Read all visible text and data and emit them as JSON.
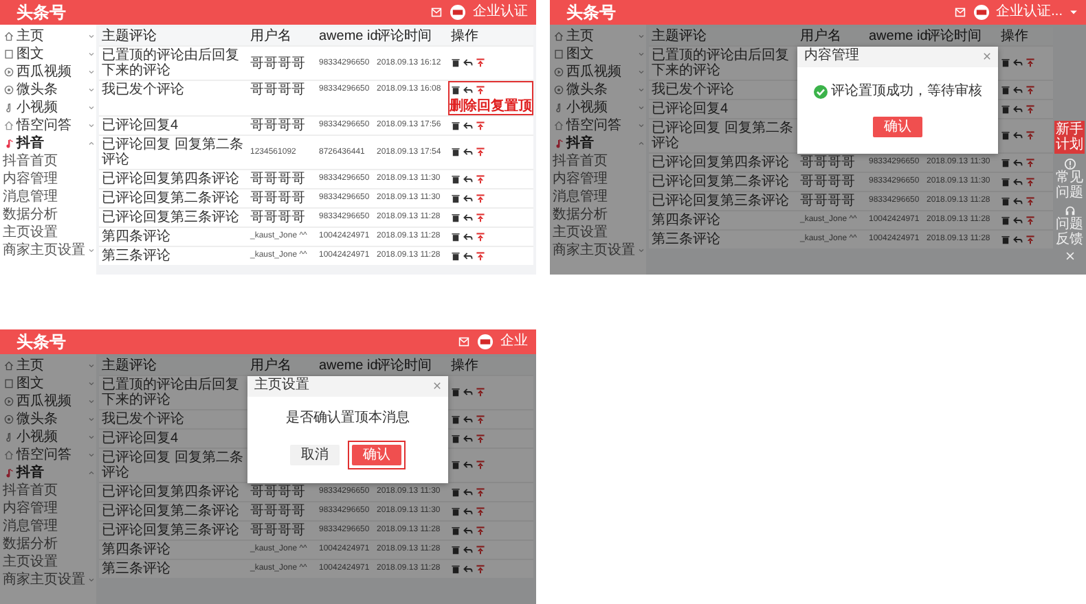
{
  "panels": [
    {
      "header": {
        "logo": "头条号",
        "account": "企业认证"
      },
      "sidebar": [
        {
          "label": "主页",
          "expanded": false
        },
        {
          "label": "图文",
          "expanded": false
        },
        {
          "label": "西瓜视频",
          "expanded": false
        },
        {
          "label": "微头条",
          "expanded": false
        },
        {
          "label": "小视频",
          "expanded": false
        },
        {
          "label": "悟空问答",
          "expanded": false
        },
        {
          "label": "抖音",
          "expanded": true,
          "children": [
            {
              "label": "抖音首页"
            },
            {
              "label": "内容管理"
            },
            {
              "label": "消息管理"
            },
            {
              "label": "数据分析"
            },
            {
              "label": "主页设置"
            },
            {
              "label": "商家主页设置",
              "expanded": false
            }
          ]
        }
      ],
      "table": {
        "columns": [
          "主题评论",
          "用户名",
          "aweme id",
          "评论时间",
          "操作"
        ],
        "rows": [
          {
            "comment": "已置顶的评论由后回复下来的评论",
            "user": "哥哥哥哥",
            "aweme_id": "98334296650",
            "time": "2018.09.13 16:12"
          },
          {
            "comment": "我已发个评论",
            "user": "哥哥哥哥",
            "aweme_id": "98334296650",
            "time": "2018.09.13 16:08",
            "annotation": {
              "labels": [
                "删除",
                "回复",
                "置顶"
              ]
            }
          },
          {
            "comment": "已评论回复4",
            "user": "哥哥哥哥",
            "aweme_id": "98334296650",
            "time": "2018.09.13 17:56"
          },
          {
            "comment": "已评论回复 回复第二条评论",
            "user": "1234561092",
            "aweme_id": "8726436441",
            "time": "2018.09.13 17:54"
          },
          {
            "comment": "已评论回复第四条评论",
            "user": "哥哥哥哥",
            "aweme_id": "98334296650",
            "time": "2018.09.13 11:30"
          },
          {
            "comment": "已评论回复第二条评论",
            "user": "哥哥哥哥",
            "aweme_id": "98334296650",
            "time": "2018.09.13 11:30"
          },
          {
            "comment": "已评论回复第三条评论",
            "user": "哥哥哥哥",
            "aweme_id": "98334296650",
            "time": "2018.09.13 11:28"
          },
          {
            "comment": "第四条评论",
            "user": "_kaust_Jone ^^",
            "aweme_id": "10042424971",
            "time": "2018.09.13 11:28"
          },
          {
            "comment": "第三条评论",
            "user": "_kaust_Jone ^^",
            "aweme_id": "10042424971",
            "time": "2018.09.13 11:28"
          }
        ]
      }
    },
    {
      "header": {
        "logo": "头条号",
        "account": "企业认证...",
        "account_menu": true
      },
      "sidebar": [
        {
          "label": "主页",
          "expanded": false
        },
        {
          "label": "图文",
          "expanded": false
        },
        {
          "label": "西瓜视频",
          "expanded": false
        },
        {
          "label": "微头条",
          "expanded": false
        },
        {
          "label": "小视频",
          "expanded": false
        },
        {
          "label": "悟空问答",
          "expanded": false
        },
        {
          "label": "抖音",
          "expanded": true,
          "children": [
            {
              "label": "抖音首页"
            },
            {
              "label": "内容管理"
            },
            {
              "label": "消息管理"
            },
            {
              "label": "数据分析"
            },
            {
              "label": "主页设置"
            },
            {
              "label": "商家主页设置",
              "expanded": false
            }
          ]
        }
      ],
      "table": {
        "columns": [
          "主题评论",
          "用户名",
          "aweme id",
          "评论时间",
          "操作"
        ],
        "rows": [
          {
            "comment": "已置顶的评论由后回复下来的评论"
          },
          {
            "comment": "我已发个评论"
          },
          {
            "comment": "已评论回复4"
          },
          {
            "comment": "已评论回复 回复第二条评论"
          },
          {
            "comment": "已评论回复第四条评论",
            "user": "哥哥哥哥",
            "aweme_id": "98334296650",
            "time": "2018.09.13 11:30"
          },
          {
            "comment": "已评论回复第二条评论",
            "user": "哥哥哥哥",
            "aweme_id": "98334296650",
            "time": "2018.09.13 11:30"
          },
          {
            "comment": "已评论回复第三条评论",
            "user": "哥哥哥哥",
            "aweme_id": "98334296650",
            "time": "2018.09.13 11:28"
          },
          {
            "comment": "第四条评论",
            "user": "_kaust_Jone ^^",
            "aweme_id": "10042424971",
            "time": "2018.09.13 11:28"
          },
          {
            "comment": "第三条评论",
            "user": "_kaust_Jone ^^",
            "aweme_id": "10042424971",
            "time": "2018.09.13 11:28"
          }
        ]
      },
      "dialog": {
        "kind": "notice",
        "title": "内容管理",
        "message": "评论置顶成功，等待审核",
        "buttons": [
          {
            "label": "确认",
            "primary": true,
            "highlighted": false
          }
        ]
      },
      "help_widget": {
        "badge": "新手计划",
        "items": [
          "常见问题",
          "问题反馈"
        ]
      }
    },
    {
      "header": {
        "logo": "头条号",
        "account": "企业"
      },
      "sidebar": [
        {
          "label": "主页",
          "expanded": false
        },
        {
          "label": "图文",
          "expanded": false
        },
        {
          "label": "西瓜视频",
          "expanded": false
        },
        {
          "label": "微头条",
          "expanded": false
        },
        {
          "label": "小视频",
          "expanded": false
        },
        {
          "label": "悟空问答",
          "expanded": false
        },
        {
          "label": "抖音",
          "expanded": true,
          "children": [
            {
              "label": "抖音首页"
            },
            {
              "label": "内容管理"
            },
            {
              "label": "消息管理"
            },
            {
              "label": "数据分析"
            },
            {
              "label": "主页设置"
            },
            {
              "label": "商家主页设置",
              "expanded": false
            }
          ]
        }
      ],
      "table": {
        "columns": [
          "主题评论",
          "用户名",
          "aweme id",
          "评论时间",
          "操作"
        ],
        "rows": [
          {
            "comment": "已置顶的评论由后回复下来的评论"
          },
          {
            "comment": "我已发个评论"
          },
          {
            "comment": "已评论回复4"
          },
          {
            "comment": "已评论回复 回复第二条评论"
          },
          {
            "comment": "已评论回复第四条评论",
            "user": "哥哥哥哥",
            "aweme_id": "98334296650",
            "time": "2018.09.13 11:30"
          },
          {
            "comment": "已评论回复第二条评论",
            "user": "哥哥哥哥",
            "aweme_id": "98334296650",
            "time": "2018.09.13 11:30"
          },
          {
            "comment": "已评论回复第三条评论",
            "user": "哥哥哥哥",
            "aweme_id": "98334296650",
            "time": "2018.09.13 11:28"
          },
          {
            "comment": "第四条评论",
            "user": "_kaust_Jone ^^",
            "aweme_id": "10042424971",
            "time": "2018.09.13 11:28"
          },
          {
            "comment": "第三条评论",
            "user": "_kaust_Jone ^^",
            "aweme_id": "10042424971",
            "time": "2018.09.13 11:28"
          }
        ]
      },
      "dialog": {
        "kind": "confirm",
        "title": "主页设置",
        "message": "是否确认置顶本消息",
        "buttons": [
          {
            "label": "取消",
            "primary": false,
            "highlighted": false
          },
          {
            "label": "确认",
            "primary": true,
            "highlighted": true
          }
        ]
      }
    }
  ]
}
